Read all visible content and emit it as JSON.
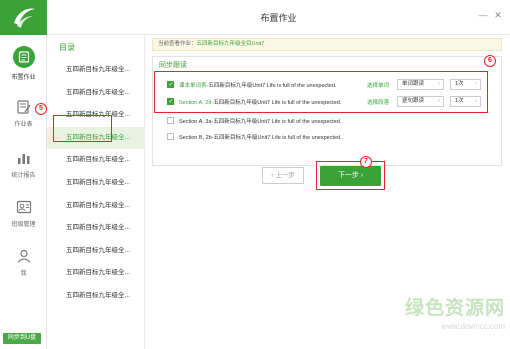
{
  "window": {
    "title": "布置作业",
    "minimize": "—",
    "close": "✕"
  },
  "nav": {
    "items": [
      {
        "label": "布置作业",
        "icon": "assign-homework-icon",
        "active": true
      },
      {
        "label": "作业表",
        "icon": "homework-list-icon",
        "active": false
      },
      {
        "label": "统计报告",
        "icon": "stats-report-icon",
        "active": false
      },
      {
        "label": "班级管理",
        "icon": "class-manage-icon",
        "active": false
      },
      {
        "label": "我",
        "icon": "user-icon",
        "active": false
      }
    ],
    "sync_label": "同步到U盘"
  },
  "directory": {
    "title": "目录",
    "items": [
      "五四新目标九年级全...",
      "五四新目标九年级全...",
      "五四新目标九年级全...",
      "五四新目标九年级全...",
      "五四新目标九年级全...",
      "五四新目标九年级全...",
      "五四新目标九年级全...",
      "五四新目标九年级全...",
      "五四新目标九年级全...",
      "五四新目标九年级全...",
      "五四新目标九年级全..."
    ],
    "active_index": 3
  },
  "notice": {
    "prefix": "当前查看作业：",
    "value": "五四新目标九年级全目Unit7"
  },
  "panel": {
    "title": "同步跟读",
    "rows": [
      {
        "checked": true,
        "prefix": "课本单词表-",
        "text": "五四新目标九年级Unit7 Life is full of the unexpected.",
        "link": "选择单词",
        "mode": "单词跟读",
        "times": "1次"
      },
      {
        "checked": true,
        "prefix": "Section A, 2d-",
        "text": "五四新目标九年级Unit7 Life is full of the unexpected.",
        "link": "选择段落",
        "mode": "逐句跟读",
        "times": "1次"
      },
      {
        "checked": false,
        "prefix": "Section A, 3a-",
        "text": "五四新目标九年级Unit7 Life is full of the unexpected.",
        "link": "",
        "mode": "",
        "times": ""
      },
      {
        "checked": false,
        "prefix": "Section B, 2b-",
        "text": "五四新目标九年级Unit7 Life is full of the unexpected.",
        "link": "",
        "mode": "",
        "times": ""
      }
    ]
  },
  "buttons": {
    "prev": "上一步",
    "next": "下一步"
  },
  "annotations": {
    "five": "5",
    "six": "6",
    "seven": "7"
  },
  "watermark": {
    "cn": "绿色资源网",
    "url": "www.downcc.com"
  },
  "colors": {
    "brand_green": "#3aa338",
    "highlight_red": "#e8232a"
  }
}
